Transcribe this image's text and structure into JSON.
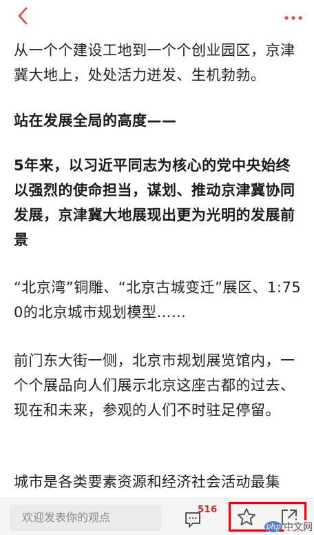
{
  "header": {
    "back_icon": "chevron-left-icon",
    "more_icon": "more-dots-icon",
    "accent_color": "#e64340"
  },
  "article": {
    "paragraphs": [
      {
        "text": "从一个个建设工地到一个个创业园区，京津冀大地上，处处活力迸发、生机勃勃。",
        "bold": false
      },
      {
        "text": "站在发展全局的高度——",
        "bold": true
      },
      {
        "text": "5年来，以习近平同志为核心的党中央始终以强烈的使命担当，谋划、推动京津冀协同发展，京津冀大地展现出更为光明的发展前景",
        "bold": true
      },
      {
        "text": "“北京湾”铜雕、“北京古城变迁”展区、1:750的北京城市规划模型……",
        "bold": false
      },
      {
        "text": "前门东大街一侧，北京市规划展览馆内，一个个展品向人们展示北京这座古都的过去、现在和未来，参观的人们不时驻足停留。",
        "bold": false
      },
      {
        "text": "城市是各类要素资源和经济社会活动最集",
        "bold": false
      }
    ]
  },
  "bottom_bar": {
    "comment_placeholder": "欢迎发表你的观点",
    "comment_count": "516",
    "comment_icon": "comment-icon",
    "favorite_icon": "star-icon",
    "share_icon": "share-icon",
    "highlight_color": "#e60012"
  },
  "watermark": {
    "logo_text": "php",
    "site_text": "中文网"
  }
}
